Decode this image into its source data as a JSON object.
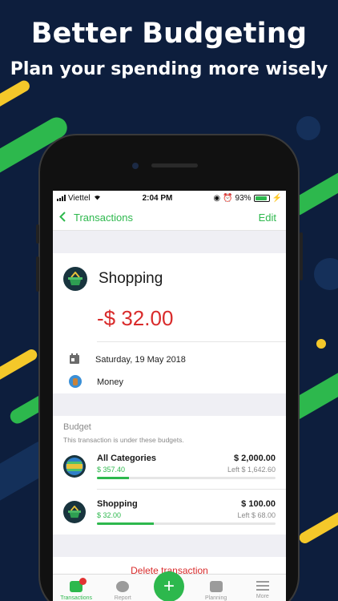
{
  "promo": {
    "headline": "Better Budgeting",
    "subline": "Plan your spending more wisely"
  },
  "colors": {
    "background": "#0d1e3d",
    "accent_green": "#2db84d",
    "expense_red": "#d92b2b",
    "stripe_yellow": "#f4c82a"
  },
  "status_bar": {
    "carrier": "Viettel",
    "time": "2:04 PM",
    "battery": "93%",
    "battery_level": 0.93
  },
  "nav": {
    "back_icon": "chevron-left-icon",
    "title": "Transactions",
    "edit_label": "Edit"
  },
  "transaction": {
    "category_icon": "shopping-basket-icon",
    "category": "Shopping",
    "amount": "-$ 32.00",
    "date_icon": "calendar-icon",
    "date": "Saturday, 19 May 2018",
    "wallet_icon": "money-jar-icon",
    "wallet": "Money"
  },
  "budget": {
    "title": "Budget",
    "subtitle": "This transaction is under these budgets.",
    "items": [
      {
        "icon": "globe-icon",
        "name": "All Categories",
        "total": "$ 2,000.00",
        "spent": "$ 357.40",
        "left": "Left $ 1,642.60",
        "progress": 0.18
      },
      {
        "icon": "shopping-basket-icon",
        "name": "Shopping",
        "total": "$ 100.00",
        "spent": "$ 32.00",
        "left": "Left $ 68.00",
        "progress": 0.32
      }
    ]
  },
  "delete_label": "Delete transaction",
  "tabbar": {
    "tabs": [
      {
        "icon": "wallet-icon",
        "label": "Transactions",
        "active": true,
        "badge": true
      },
      {
        "icon": "pie-chart-icon",
        "label": "Report",
        "active": false
      },
      {
        "icon": "plus-icon",
        "label": "+",
        "active": false
      },
      {
        "icon": "planning-icon",
        "label": "Planning",
        "active": false
      },
      {
        "icon": "menu-icon",
        "label": "More",
        "active": false
      }
    ]
  }
}
